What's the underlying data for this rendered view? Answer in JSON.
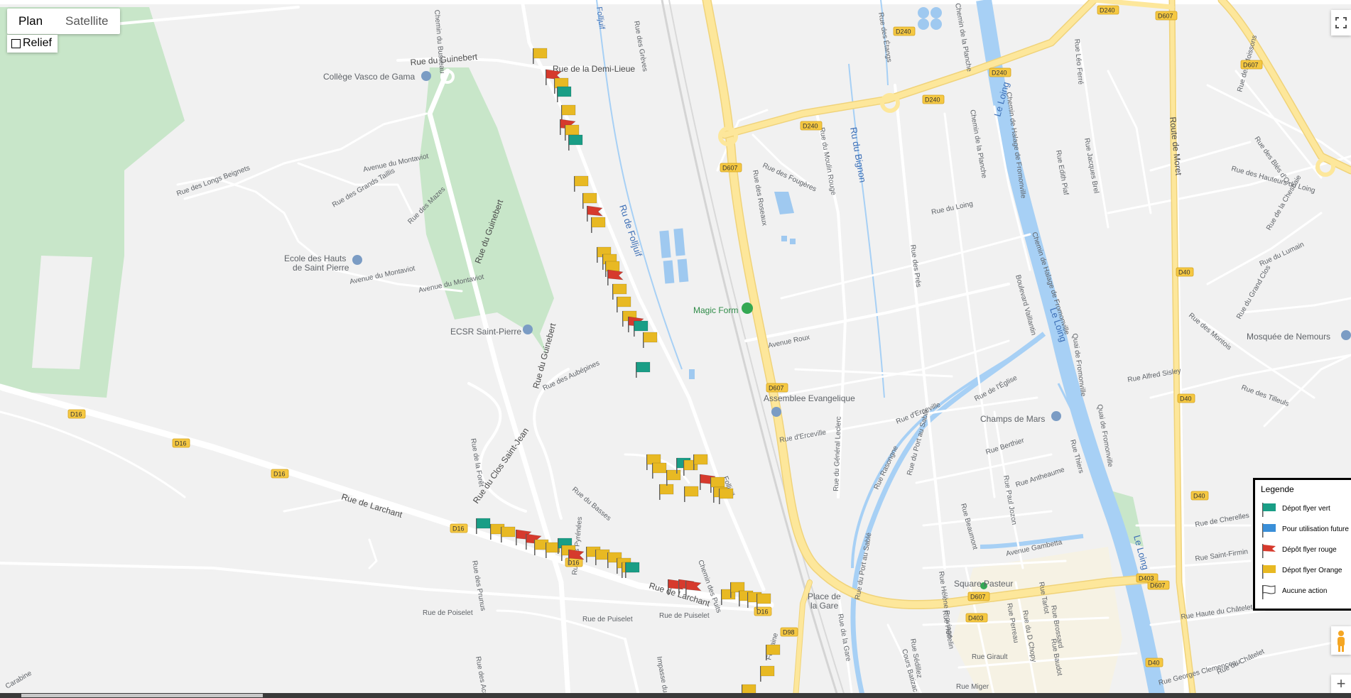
{
  "map_controls": {
    "map_type_options": [
      "Plan",
      "Satellite"
    ],
    "active_map_type": "Plan",
    "relief_label": "Relief",
    "relief_checked": false
  },
  "legend": {
    "title": "Legende",
    "items": [
      {
        "label": "Dépot flyer vert",
        "color": "#1a9e86",
        "icon": "flag-green-icon"
      },
      {
        "label": "Pour utilisation future",
        "color": "#3a8fd8",
        "icon": "flag-blue-icon"
      },
      {
        "label": "Dépôt flyer rouge",
        "color": "#d63a2d",
        "icon": "flag-red-icon"
      },
      {
        "label": "Dépot flyer Orange",
        "color": "#e8b923",
        "icon": "flag-orange-icon"
      },
      {
        "label": "Aucune action",
        "color": "#ffffff",
        "icon": "flag-white-icon"
      }
    ]
  },
  "pois": [
    {
      "name": "Collège Vasco de Gama",
      "icon": "school-icon"
    },
    {
      "name": "Ecole des Hauts de Saint Pierre",
      "line1": "Ecole des Hauts",
      "line2": "de Saint Pierre",
      "icon": "school-icon"
    },
    {
      "name": "ECSR Saint-Pierre",
      "icon": "place-icon"
    },
    {
      "name": "Magic Form",
      "icon": "gym-icon"
    },
    {
      "name": "Assemblee Evangelique",
      "icon": "church-icon"
    },
    {
      "name": "Champs de Mars",
      "icon": "place-icon"
    },
    {
      "name": "Mosquée de Nemours",
      "icon": "mosque-icon"
    },
    {
      "name": "Square Pasteur",
      "icon": "park-icon"
    },
    {
      "name": "Place de la Gare",
      "line1": "Place de",
      "line2": "la Gare",
      "icon": ""
    }
  ],
  "street_labels": {
    "guinebert_top": "Rue du Guinebert",
    "demi_lieue": "Rue de la Demi-Lieue",
    "guinebert_mid": "Rue du Guinebert",
    "guinebert_low": "Rue du Guinebert",
    "montaviot1": "Avenue du Montaviot",
    "montaviot2": "Avenue du Montaviot",
    "montaviot3": "Avenue du Montaviot",
    "longs_beignets": "Rue des Longs Beignets",
    "grands_taillis": "Rue des Grands Taillis",
    "mazes": "Rue des Mazes",
    "aubepines": "Rue des Aubépines",
    "clos_saint_jean": "Rue du Clos Saint-Jean",
    "larchant1": "Rue de Larchant",
    "larchant2": "Rue de Larchant",
    "poiselet": "Rue de Poiselet",
    "puiselet1": "Rue de Puiselet",
    "puiselet2": "Rue de Puiselet",
    "la_foret": "Rue de la Forêt",
    "pyrenees": "Rue des Pyrénées",
    "prunus": "Rue des Prunus",
    "basses": "Rue du Basses",
    "folljuif_top": "Folljuif",
    "folljuif_mid": "Ru de Folljuif",
    "folljuif_road": "Folljuif",
    "greves": "Rue des Grèves",
    "chemin_busseau": "Chemin du Busseau",
    "etangs": "Rue des Étangs",
    "planche1": "Chemin de la Planche",
    "planche2": "Chemin de la Planche",
    "fougeres": "Rue des Fougères",
    "roseaux": "Rue des Roseaux",
    "moulin_rouge": "Rue du Moulin Rouge",
    "bignon": "Ru du Bignon",
    "loing_street": "Rue du Loing",
    "pres": "Rue des Prés",
    "avenue_roux": "Avenue Roux",
    "erceville1": "Rue d'Erceville",
    "erceville2": "Rue d'Erceville",
    "general_leclerc": "Rue du Général Leclerc",
    "port_sable1": "Rue du Port au Sablé",
    "port_sable2": "Rue du Port au Sablé",
    "eglise": "Rue de l'Église",
    "berthier": "Rue Berthier",
    "antheaume": "Rue Antheaume",
    "beaumont": "Rue Beaumont",
    "thiers": "Rue Thiers",
    "jozon": "Rue Paul Jozon",
    "gambetta": "Avenue Gambetta",
    "helene": "Rue Hélène Provinge",
    "halage1": "Chemin de Halage de Fromonville",
    "halage2": "Chemin de Halage de Fromonville",
    "quai_fromonville": "Quai de Fromonville",
    "quai_fromonville2": "Quai de Fromonville",
    "vaillantin": "Boulevard Vaillantin",
    "leo_ferre": "Rue Léo Ferré",
    "jacques_brel": "Rue Jacques Brel",
    "edith_piaf": "Rue Edith Piaf",
    "route_moret": "Route de Moret",
    "moissons": "Rue des Moissons",
    "bles": "Rue des Blés d'Or",
    "hauteurs": "Rue des Hauteurs du Loing",
    "la_chesnaie": "Rue de la Chesnaie",
    "lumain": "Rue du Lumain",
    "grand_clos": "Rue du Grand Clos",
    "montois": "Rue des Montois",
    "alfred_sisley": "Rue Alfred Sisley",
    "tilleuls": "Rue des Tilleuls",
    "cherelles": "Rue de Cherelles",
    "saint_firmin": "Rue Saint-Firmin",
    "haute_chatelet": "Rue Haute du Châtelet",
    "giraut": "Rue Girault",
    "miger": "Rue Miger",
    "gare": "Rue de la Gare",
    "baudot": "Rue Baudot",
    "perreau": "Rue Perreau",
    "chemin_puits": "Chemin des Puits",
    "impasse": "Impasse du C...",
    "fontaine": "Fontaine",
    "carabine": "Carabine",
    "acacias": "Rue des Acacias",
    "sedillez": "Rue Sédillez",
    "rasongne": "Rue Rasongne",
    "helvin": "Rue Hédelin",
    "georges": "Rue Georges Clemenceau",
    "chatelet": "Rue du Châtelet",
    "cours_batizac": "Cours Batizac",
    "tarlot": "Rue Tarlot",
    "d_chopy": "Rue du D Chopy",
    "brossard": "Rue Brossard"
  },
  "water_labels": {
    "loing1": "Le Loing",
    "loing2": "Le Loing",
    "loing3": "Le Loing"
  },
  "road_shields": [
    "D240",
    "D240",
    "D240",
    "D240",
    "D240",
    "D607",
    "D607",
    "D607",
    "D607",
    "D607",
    "D607",
    "D40",
    "D40",
    "D40",
    "D40",
    "D403",
    "D403",
    "D16",
    "D16",
    "D16",
    "D16",
    "D16",
    "D16",
    "D98"
  ],
  "flag_counts": {
    "green": 9,
    "red": 12,
    "orange": 54
  }
}
